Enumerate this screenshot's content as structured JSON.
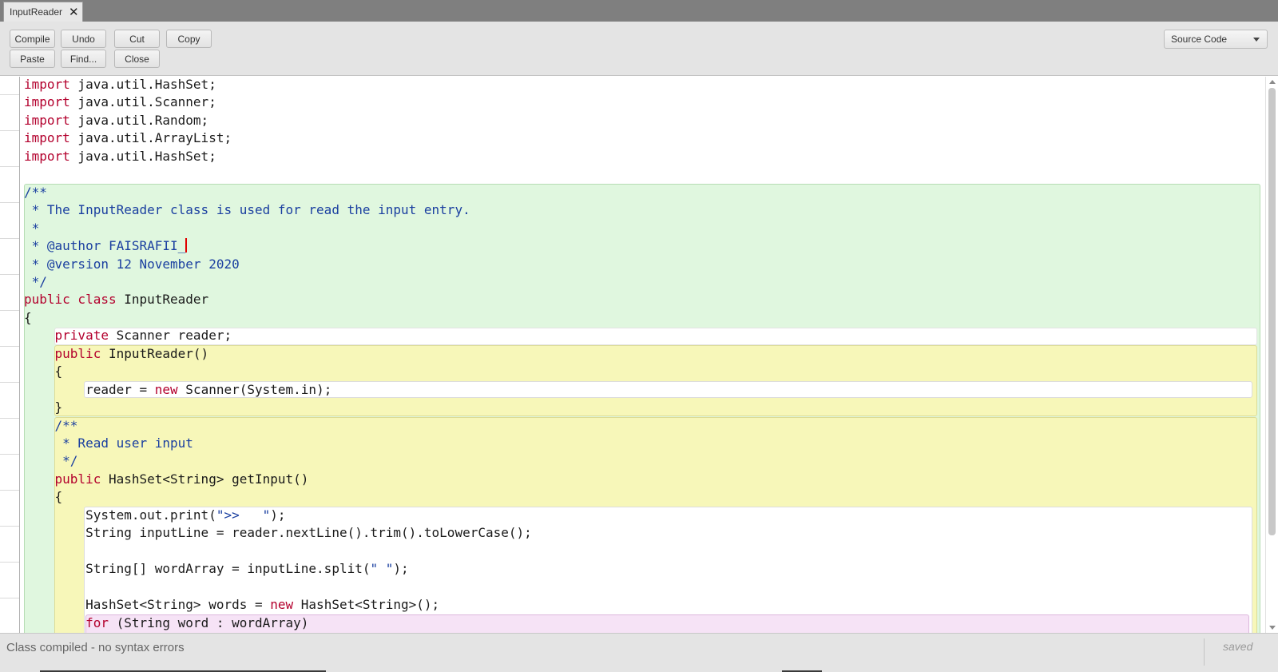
{
  "tab": {
    "title": "InputReader",
    "close_glyph": "✕"
  },
  "toolbar": {
    "compile": "Compile",
    "undo": "Undo",
    "cut": "Cut",
    "copy": "Copy",
    "paste": "Paste",
    "find": "Find...",
    "close": "Close",
    "view_select": "Source Code"
  },
  "code": {
    "lines": [
      [
        {
          "t": "import",
          "c": "kw"
        },
        {
          "t": " java.util.HashSet;"
        }
      ],
      [
        {
          "t": "import",
          "c": "kw"
        },
        {
          "t": " java.util.Scanner;"
        }
      ],
      [
        {
          "t": "import",
          "c": "kw"
        },
        {
          "t": " java.util.Random;"
        }
      ],
      [
        {
          "t": "import",
          "c": "kw"
        },
        {
          "t": " java.util.ArrayList;"
        }
      ],
      [
        {
          "t": "import",
          "c": "kw"
        },
        {
          "t": " java.util.HashSet;"
        }
      ],
      [],
      [
        {
          "t": "/**",
          "c": "cm"
        }
      ],
      [
        {
          "t": " * The InputReader class is used for read the input entry.",
          "c": "cm"
        }
      ],
      [
        {
          "t": " *",
          "c": "cm"
        }
      ],
      [
        {
          "t": " * @author FAISRAFII_",
          "c": "cm"
        },
        {
          "cursor": true
        }
      ],
      [
        {
          "t": " * @version 12 November 2020",
          "c": "cm"
        }
      ],
      [
        {
          "t": " */",
          "c": "cm"
        }
      ],
      [
        {
          "t": "public class",
          "c": "kw"
        },
        {
          "t": " InputReader"
        }
      ],
      [
        {
          "t": "{"
        }
      ],
      [
        {
          "t": "    "
        },
        {
          "t": "private",
          "c": "kw"
        },
        {
          "t": " Scanner reader;"
        }
      ],
      [
        {
          "t": "    "
        },
        {
          "t": "public",
          "c": "kw"
        },
        {
          "t": " InputReader()"
        }
      ],
      [
        {
          "t": "    {"
        }
      ],
      [
        {
          "t": "        reader = "
        },
        {
          "t": "new",
          "c": "kw"
        },
        {
          "t": " Scanner(System.in);"
        }
      ],
      [
        {
          "t": "    }"
        }
      ],
      [
        {
          "t": "    /**",
          "c": "cm"
        }
      ],
      [
        {
          "t": "     * Read user input",
          "c": "cm"
        }
      ],
      [
        {
          "t": "     */",
          "c": "cm"
        }
      ],
      [
        {
          "t": "    "
        },
        {
          "t": "public",
          "c": "kw"
        },
        {
          "t": " HashSet<String> getInput()"
        }
      ],
      [
        {
          "t": "    {"
        }
      ],
      [
        {
          "t": "        System.out.print("
        },
        {
          "t": "\">>   \"",
          "c": "str"
        },
        {
          "t": ");"
        }
      ],
      [
        {
          "t": "        String inputLine = reader.nextLine().trim().toLowerCase();"
        }
      ],
      [],
      [
        {
          "t": "        String[] wordArray = inputLine.split("
        },
        {
          "t": "\" \"",
          "c": "str"
        },
        {
          "t": ");"
        }
      ],
      [],
      [
        {
          "t": "        HashSet<String> words = "
        },
        {
          "t": "new",
          "c": "kw"
        },
        {
          "t": " HashSet<String>();"
        }
      ],
      [
        {
          "t": "        "
        },
        {
          "t": "for",
          "c": "kw"
        },
        {
          "t": " (String word : wordArray)"
        }
      ]
    ]
  },
  "status": {
    "message": "Class compiled - no syntax errors",
    "saved": "saved"
  }
}
